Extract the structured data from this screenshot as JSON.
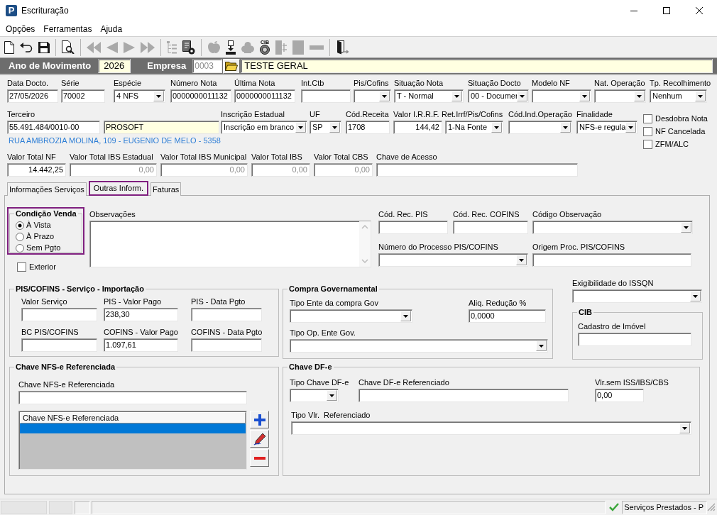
{
  "window": {
    "logo": "P",
    "title": "Escrituração"
  },
  "menu": [
    "Opções",
    "Ferramentas",
    "Ajuda"
  ],
  "toolbar_groups": [
    [
      {
        "kind": "new",
        "disabled": false
      },
      {
        "kind": "undo",
        "disabled": false
      },
      {
        "kind": "save",
        "disabled": false
      }
    ],
    [
      {
        "kind": "preview",
        "disabled": false
      }
    ],
    [
      {
        "kind": "first",
        "disabled": true
      },
      {
        "kind": "previous",
        "disabled": true
      },
      {
        "kind": "next",
        "disabled": true
      },
      {
        "kind": "last",
        "disabled": true
      }
    ],
    [
      {
        "kind": "tree",
        "disabled": true
      },
      {
        "kind": "report",
        "disabled": false
      }
    ],
    [
      {
        "kind": "blob",
        "disabled": true
      },
      {
        "kind": "stamp",
        "disabled": false
      },
      {
        "kind": "cloud",
        "disabled": true
      },
      {
        "kind": "coin",
        "label": "CIB",
        "disabled": false
      },
      {
        "kind": "panel",
        "disabled": true
      },
      {
        "kind": "square",
        "disabled": true
      },
      {
        "kind": "bar",
        "disabled": true
      }
    ],
    [
      {
        "kind": "exit",
        "disabled": false
      }
    ]
  ],
  "movement_bar": {
    "year_label": "Ano de Movimento",
    "year": {
      "value": "2026",
      "readonly": true
    },
    "company_label": "Empresa",
    "company_code": {
      "value": "0003",
      "disabled": true
    },
    "company_name": {
      "value": "TESTE GERAL",
      "readonly": true
    }
  },
  "document_fields": [
    {
      "label": "Data Docto.",
      "kind": "text",
      "value": "27/05/2026"
    },
    {
      "label": "Série",
      "kind": "text",
      "value": "70002"
    },
    {
      "label": "Espécie",
      "kind": "select",
      "value": "4 NFS"
    },
    {
      "label": "Número Nota",
      "kind": "text",
      "value": "0000000011132"
    },
    {
      "label": "Última Nota",
      "kind": "text",
      "value": "0000000011132"
    },
    {
      "label": "Int.Ctb",
      "kind": "text"
    },
    {
      "label": "Pis/Cofins",
      "kind": "select"
    },
    {
      "label": "Situação Nota",
      "kind": "select",
      "value": "T - Normal"
    },
    {
      "label": "Situação Docto",
      "kind": "select",
      "value": "00 - Documer"
    },
    {
      "label": "Modelo NF",
      "kind": "select"
    },
    {
      "label": "Nat. Operação",
      "kind": "select"
    },
    {
      "label": "Tp. Recolhimento",
      "kind": "select",
      "value": "Nenhum"
    }
  ],
  "third_party": {
    "label": "Terceiro",
    "fields": [
      {
        "kind": "text",
        "value": "55.491.484/0010-00",
        "readonly": false
      },
      {
        "kind": "text",
        "value": "PROSOFT",
        "readonly": true
      }
    ],
    "address": "RUA AMBROZIA MOLINA, 109 - EUGENIO DE MELO - 5358"
  },
  "tax_fields": [
    {
      "label": "Inscrição Estadual",
      "kind": "select",
      "value": "Inscrição em branco"
    },
    {
      "label": "UF",
      "kind": "select",
      "value": "SP"
    },
    {
      "label": "Cód.Receita",
      "kind": "text",
      "value": "1708"
    },
    {
      "label": "Valor I.R.R.F.",
      "kind": "number",
      "value": "144,42"
    },
    {
      "label": "Ret.Irrf/Pis/Cofins",
      "kind": "select",
      "value": "1-Na Fonte"
    },
    {
      "label": "Cód.Ind.Operação",
      "kind": "select"
    },
    {
      "label": "Finalidade",
      "kind": "select",
      "value": "NFS-e regula"
    }
  ],
  "flags": [
    {
      "label": "Desdobra Nota",
      "checked": false
    },
    {
      "label": "NF Cancelada",
      "checked": false
    },
    {
      "label": "ZFM/ALC",
      "checked": false
    }
  ],
  "totals": [
    {
      "label": "Valor Total NF",
      "kind": "number",
      "value": "14.442,25",
      "disabled": false
    },
    {
      "label": "Valor Total IBS Estadual",
      "kind": "number",
      "value": "0,00",
      "disabled": true
    },
    {
      "label": "Valor Total IBS Municipal",
      "kind": "number",
      "value": "0,00",
      "disabled": true
    },
    {
      "label": "Valor Total IBS",
      "kind": "number",
      "value": "0,00",
      "disabled": true
    },
    {
      "label": "Valor Total CBS",
      "kind": "number",
      "value": "0,00",
      "disabled": true
    },
    {
      "label": "Chave de Acesso",
      "kind": "text"
    }
  ],
  "tabs": [
    {
      "label": "Informações Serviços",
      "selected": false
    },
    {
      "label": "Outras Inform.",
      "selected": true
    },
    {
      "label": "Faturas",
      "selected": false
    }
  ],
  "sale_condition": {
    "title": "Condição Venda",
    "highlighted": true,
    "options": [
      {
        "label": "À Vista",
        "selected": true
      },
      {
        "label": "À Prazo",
        "selected": false
      },
      {
        "label": "Sem Pgto",
        "selected": false
      }
    ]
  },
  "exterior": {
    "label": "Exterior",
    "checked": false
  },
  "notes": {
    "label": "Observações"
  },
  "codes_fields": [
    {
      "label": "Cód. Rec. PIS",
      "kind": "text"
    },
    {
      "label": "Cód. Rec. COFINS",
      "kind": "text"
    },
    {
      "label": "Código Observação",
      "kind": "select"
    },
    {
      "label": "Número do Processo PIS/COFINS",
      "kind": "select"
    },
    {
      "label": "Origem Proc. PIS/COFINS",
      "kind": "text"
    }
  ],
  "pis_cofins_import": {
    "title": "PIS/COFINS - Serviço - Importação",
    "fields": [
      {
        "label": "Valor Serviço",
        "kind": "text"
      },
      {
        "label": "PIS - Valor Pago",
        "kind": "text",
        "value": "238,30"
      },
      {
        "label": "PIS - Data Pgto",
        "kind": "text"
      },
      {
        "label": "BC PIS/COFINS",
        "kind": "text"
      },
      {
        "label": "COFINS - Valor Pago",
        "kind": "text",
        "value": "1.097,61"
      },
      {
        "label": "COFINS - Data Pgto",
        "kind": "text"
      }
    ]
  },
  "government_purchase": {
    "title": "Compra Governamental",
    "fields": [
      {
        "label": "Tipo Ente da compra Gov",
        "kind": "select"
      },
      {
        "label": "Aliq. Redução %",
        "kind": "text",
        "value": "0,0000"
      },
      {
        "label": "Tipo Op. Ente Gov.",
        "kind": "select"
      }
    ]
  },
  "issqn": {
    "label": "Exigibilidade do ISSQN",
    "kind": "select"
  },
  "cib": {
    "title": "CIB",
    "fields": [
      {
        "label": "Cadastro de Imóvel",
        "kind": "text"
      }
    ]
  },
  "nfse_reference": {
    "title": "Chave NFS-e Referenciada",
    "field": {
      "label": "Chave NFS-e Referenciada",
      "kind": "text"
    },
    "list": {
      "column": "Chave NFS-e Referenciada",
      "rows": [
        {
          "selected": true
        }
      ]
    }
  },
  "dfe_key": {
    "title": "Chave DF-e",
    "fields": [
      {
        "label": "Tipo Chave DF-e",
        "kind": "select"
      },
      {
        "label": "Chave DF-e Referenciado",
        "kind": "text"
      },
      {
        "label": "Vlr.sem ISS/IBS/CBS",
        "kind": "text",
        "value": "0,00"
      },
      {
        "label": "Tipo Vlr.  Referenciado",
        "kind": "select"
      }
    ]
  },
  "status_bar": {
    "text": "Serviços Prestados - P"
  }
}
